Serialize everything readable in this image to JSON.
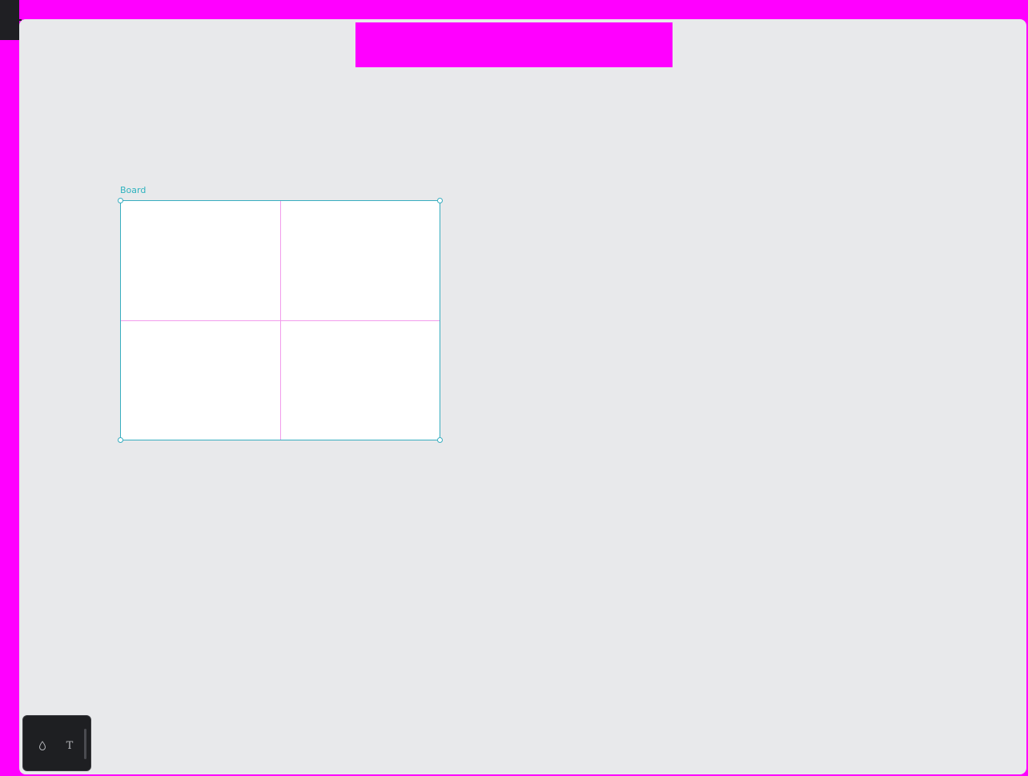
{
  "canvas": {
    "board": {
      "label": "Board"
    }
  },
  "toolbar": {
    "tools": [
      {
        "name": "fill",
        "icon": "drop-icon"
      },
      {
        "name": "text",
        "icon": "text-icon",
        "glyph": "T"
      }
    ]
  },
  "colors": {
    "board_outline": "#39aec0",
    "guide": "#f29cec",
    "canvas_bg": "#e8e9eb",
    "toolbar_bg": "#1e1f22"
  }
}
